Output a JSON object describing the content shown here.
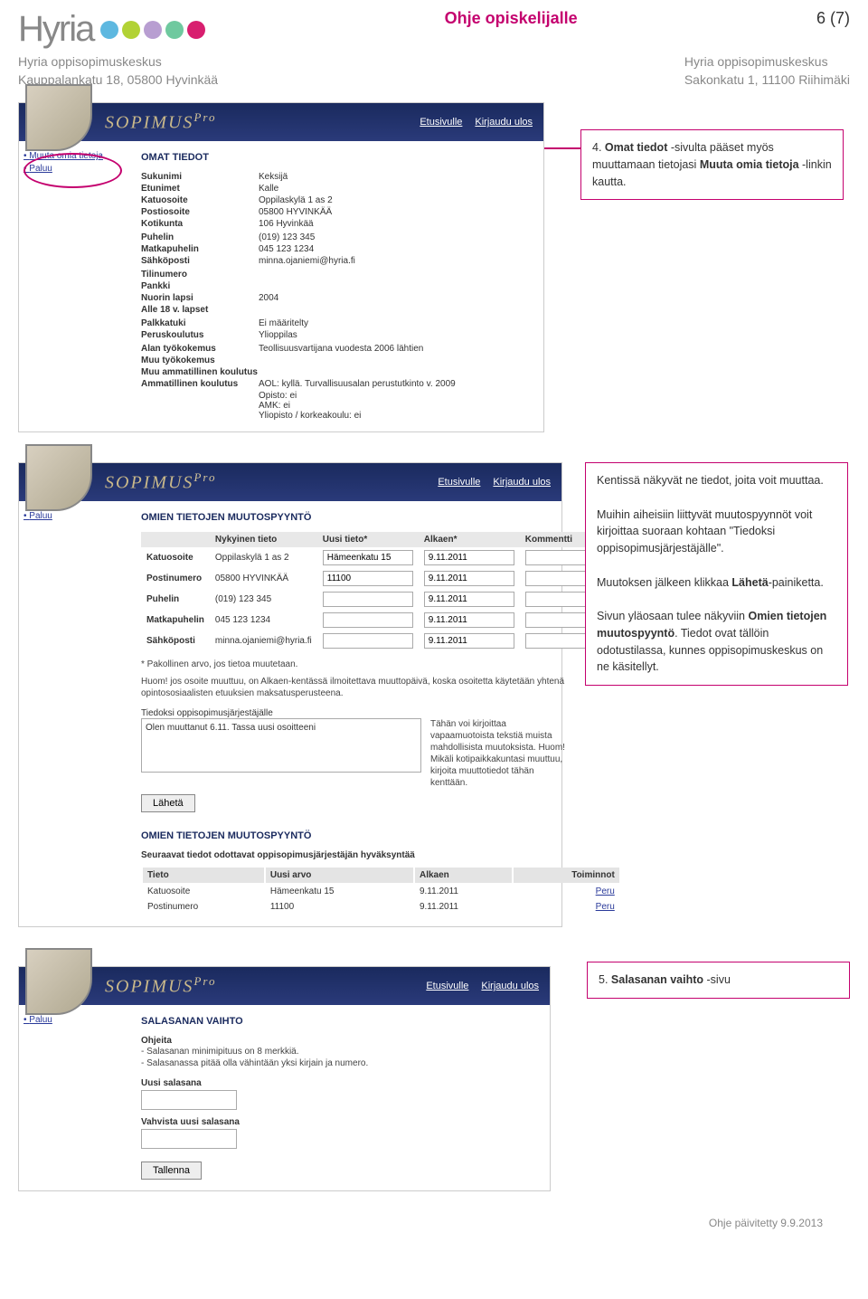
{
  "header": {
    "logo_text": "Hyria",
    "dot_colors": [
      "#5eb8e0",
      "#b2d235",
      "#b89ed1",
      "#6fc99f",
      "#d81f6f"
    ],
    "doc_title": "Ohje opiskelijalle",
    "page_num": "6 (7)"
  },
  "subhead": {
    "left_org": "Hyria oppisopimuskeskus",
    "left_addr": "Kauppalankatu 18, 05800 Hyvinkää",
    "right_org": "Hyria oppisopimuskeskus",
    "right_addr": "Sakonkatu 1, 11100 Riihimäki"
  },
  "sc1": {
    "app_title": "SOPIMUS",
    "app_sub": "Pro",
    "nav_home": "Etusivulle",
    "nav_logout": "Kirjaudu ulos",
    "sidebar": {
      "muuta": "Muuta omia tietoja",
      "paluu": "Paluu"
    },
    "title": "OMAT TIEDOT",
    "rows": [
      {
        "l": "Sukunimi",
        "v": "Keksijä"
      },
      {
        "l": "Etunimet",
        "v": "Kalle"
      },
      {
        "l": "Katuosoite",
        "v": "Oppilaskylä 1 as 2"
      },
      {
        "l": "Postiosoite",
        "v": "05800 HYVINKÄÄ"
      },
      {
        "l": "Kotikunta",
        "v": "106 Hyvinkää"
      },
      {
        "l": "",
        "v": ""
      },
      {
        "l": "Puhelin",
        "v": "(019) 123 345"
      },
      {
        "l": "Matkapuhelin",
        "v": "045 123 1234"
      },
      {
        "l": "Sähköposti",
        "v": "minna.ojaniemi@hyria.fi"
      },
      {
        "l": "",
        "v": ""
      },
      {
        "l": "Tilinumero",
        "v": ""
      },
      {
        "l": "Pankki",
        "v": ""
      },
      {
        "l": "Nuorin lapsi",
        "v": "2004"
      },
      {
        "l": "Alle 18 v. lapset",
        "v": ""
      },
      {
        "l": "",
        "v": ""
      },
      {
        "l": "Palkkatuki",
        "v": "Ei määritelty"
      },
      {
        "l": "Peruskoulutus",
        "v": "Ylioppilas"
      },
      {
        "l": "",
        "v": ""
      },
      {
        "l": "Alan työkokemus",
        "v": "Teollisuusvartijana vuodesta 2006 lähtien"
      },
      {
        "l": "Muu työkokemus",
        "v": ""
      },
      {
        "l": "Muu ammatillinen koulutus",
        "v": ""
      },
      {
        "l": "Ammatillinen koulutus",
        "v": "AOL: kyllä. Turvallisuusalan perustutkinto v. 2009"
      }
    ],
    "extra": [
      "Opisto: ei",
      "AMK: ei",
      "Yliopisto / korkeakoulu: ei"
    ]
  },
  "callout1": "4. Omat tiedot -sivulta pääset myös muuttamaan tietojasi Muuta omia tietoja -linkin kautta.",
  "sc2": {
    "title": "OMIEN TIETOJEN MUUTOSPYYNTÖ",
    "sidebar_paluu": "Paluu",
    "cols": {
      "current": "Nykyinen tieto",
      "new": "Uusi tieto*",
      "from": "Alkaen*",
      "comment": "Kommentti"
    },
    "rows": [
      {
        "f": "Katuosoite",
        "cur": "Oppilaskylä 1 as 2",
        "new": "Hämeenkatu 15",
        "from": "9.11.2011"
      },
      {
        "f": "Postinumero",
        "cur": "05800 HYVINKÄÄ",
        "new": "11100",
        "from": "9.11.2011"
      },
      {
        "f": "Puhelin",
        "cur": "(019) 123 345",
        "new": "",
        "from": "9.11.2011"
      },
      {
        "f": "Matkapuhelin",
        "cur": "045 123 1234",
        "new": "",
        "from": "9.11.2011"
      },
      {
        "f": "Sähköposti",
        "cur": "minna.ojaniemi@hyria.fi",
        "new": "",
        "from": "9.11.2011"
      }
    ],
    "mandatory": "* Pakollinen arvo, jos tietoa muutetaan.",
    "hint": "Huom! jos osoite muuttuu, on Alkaen-kentässä ilmoitettava muuttopäivä, koska osoitetta käytetään yhtenä opintososiaalisten etuuksien maksatusperusteena.",
    "msg_label": "Tiedoksi oppisopimusjärjestäjälle",
    "msg_value": "Olen muuttanut 6.11. Tassa uusi osoitteeni",
    "msg_tip": "Tähän voi kirjoittaa vapaamuotoista tekstiä muista mahdollisista muutoksista. Huom! Mikäli kotipaikkakuntasi muuttuu, kirjoita muuttotiedot tähän kenttään.",
    "send": "Lähetä",
    "pending_title": "OMIEN TIETOJEN MUUTOSPYYNTÖ",
    "pending_sub": "Seuraavat tiedot odottavat oppisopimusjärjestäjän hyväksyntää",
    "pending_cols": {
      "tieto": "Tieto",
      "uusi": "Uusi arvo",
      "alkaen": "Alkaen",
      "toim": "Toiminnot"
    },
    "pending_rows": [
      {
        "t": "Katuosoite",
        "u": "Hämeenkatu 15",
        "a": "9.11.2011",
        "p": "Peru"
      },
      {
        "t": "Postinumero",
        "u": "11100",
        "a": "9.11.2011",
        "p": "Peru"
      }
    ]
  },
  "callout2": {
    "p1": "Kentissä näkyvät ne tiedot, joita voit muuttaa.",
    "p2": "Muihin aiheisiin liittyvät muutospyynnöt voit kirjoittaa suoraan kohtaan \"Tiedoksi oppisopimusjärjestäjälle\".",
    "p3a": "Muutoksen jälkeen klikkaa ",
    "p3b": "Lähetä",
    "p3c": "-painiketta.",
    "p4a": "Sivun yläosaan tulee näkyviin ",
    "p4b": "Omien tietojen muutospyyntö",
    "p4c": ". Tiedot ovat tällöin odotustilassa, kunnes oppisopimuskeskus on ne käsitellyt."
  },
  "sc3": {
    "title": "SALASANAN VAIHTO",
    "ohjeita": "Ohjeita",
    "r1": "- Salasanan minimipituus on 8 merkkiä.",
    "r2": "- Salasanassa pitää olla vähintään yksi kirjain ja numero.",
    "new_pw": "Uusi salasana",
    "confirm_pw": "Vahvista uusi salasana",
    "save": "Tallenna",
    "sidebar_paluu": "Paluu"
  },
  "callout3": "5. Salasanan vaihto -sivu",
  "footer": "Ohje päivitetty 9.9.2013"
}
